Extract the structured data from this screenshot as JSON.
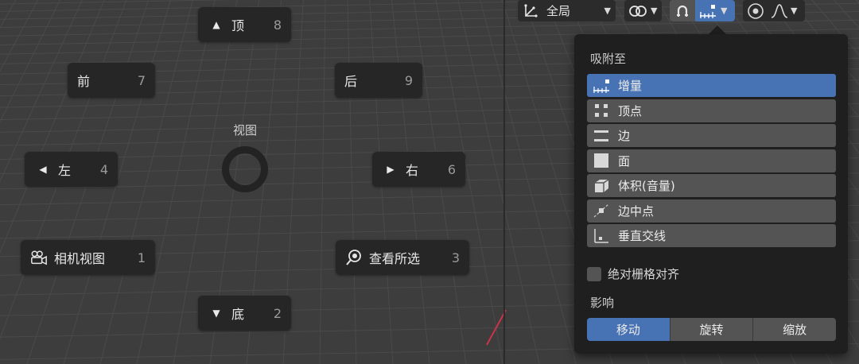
{
  "pie_menu": {
    "title": "视图",
    "buttons": {
      "top": {
        "label": "顶",
        "key": "8",
        "icon": "triangle-up-icon"
      },
      "front": {
        "label": "前",
        "key": "7"
      },
      "back": {
        "label": "后",
        "key": "9"
      },
      "left": {
        "label": "左",
        "key": "4",
        "icon": "triangle-left-icon"
      },
      "right": {
        "label": "右",
        "key": "6",
        "icon": "triangle-right-icon"
      },
      "camera": {
        "label": "相机视图",
        "key": "1",
        "icon": "camera-icon"
      },
      "selected": {
        "label": "查看所选",
        "key": "3",
        "icon": "view-selected-icon"
      },
      "bottom": {
        "label": "底",
        "key": "2",
        "icon": "triangle-down-icon"
      }
    }
  },
  "header": {
    "orientation": {
      "label": "全局",
      "icon": "transform-orientation-icon"
    },
    "pivot_icon": "pivot-point-icon",
    "snap_toggle_icon": "magnet-icon",
    "snap_mode_icon": "increment-icon",
    "proportional_icon": "proportional-edit-icon",
    "falloff_icon": "falloff-curve-icon"
  },
  "snap_popup": {
    "snap_to_title": "吸附至",
    "options": [
      {
        "label": "增量",
        "icon": "increment-icon",
        "selected": true
      },
      {
        "label": "顶点",
        "icon": "vertex-icon",
        "selected": false
      },
      {
        "label": "边",
        "icon": "edge-icon",
        "selected": false
      },
      {
        "label": "面",
        "icon": "face-icon",
        "selected": false
      },
      {
        "label": "体积(音量)",
        "icon": "volume-icon",
        "selected": false
      },
      {
        "label": "边中点",
        "icon": "edge-midpoint-icon",
        "selected": false
      },
      {
        "label": "垂直交线",
        "icon": "perpendicular-icon",
        "selected": false
      }
    ],
    "absolute_grid_label": "绝对栅格对齐",
    "absolute_grid_checked": false,
    "affect_title": "影响",
    "affect": [
      {
        "label": "移动",
        "selected": true
      },
      {
        "label": "旋转",
        "selected": false
      },
      {
        "label": "缩放",
        "selected": false
      }
    ]
  },
  "colors": {
    "accent": "#4772b3",
    "panel": "#1f1f1f",
    "button": "#262626",
    "viewport": "#3d3d3d",
    "axis_x": "#c8354a"
  }
}
